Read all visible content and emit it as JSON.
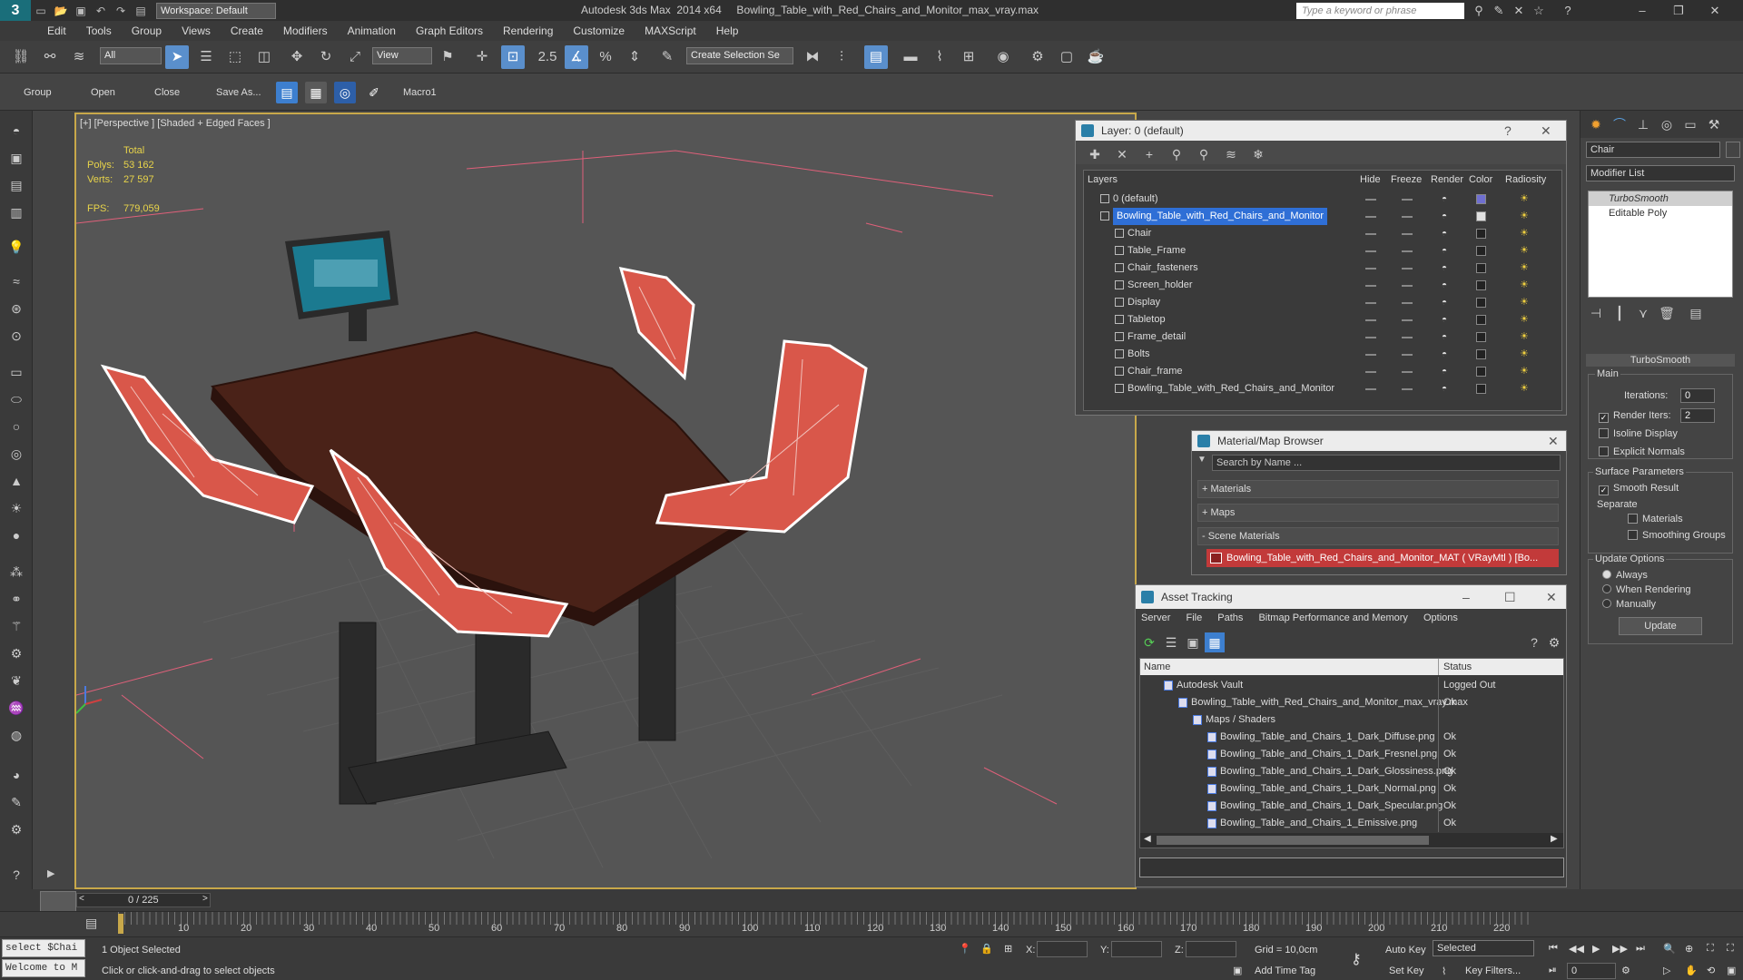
{
  "app": {
    "logo": "3",
    "workspace": "Workspace: Default",
    "window_title": "Autodesk 3ds Max  2014 x64     Bowling_Table_with_Red_Chairs_and_Monitor_max_vray.max",
    "search_placeholder": "Type a keyword or phrase"
  },
  "menu": [
    "Edit",
    "Tools",
    "Group",
    "Views",
    "Create",
    "Modifiers",
    "Animation",
    "Graph Editors",
    "Rendering",
    "Customize",
    "MAXScript",
    "Help"
  ],
  "toolbar": {
    "filter": "All",
    "ref_coord": "View",
    "snap_value": "2.5",
    "selection_set": "Create Selection Se"
  },
  "ribbon": {
    "group": "Group",
    "open": "Open",
    "close": "Close",
    "save_as": "Save As...",
    "macro": "Macro1"
  },
  "viewport": {
    "label": "[+] [Perspective ] [Shaded + Edged Faces ]",
    "total_label": "Total",
    "polys_label": "Polys:",
    "polys": "53 162",
    "verts_label": "Verts:",
    "verts": "27 597",
    "fps_label": "FPS:",
    "fps": "779,059"
  },
  "layer_panel": {
    "title": "Layer: 0 (default)",
    "help": "?",
    "close": "✕",
    "columns": [
      "Layers",
      "Hide",
      "Freeze",
      "Render",
      "Color",
      "Radiosity"
    ],
    "rows": [
      {
        "name": "0 (default)",
        "level": 0,
        "selected": false,
        "color": "#6f6fd0"
      },
      {
        "name": "Bowling_Table_with_Red_Chairs_and_Monitor",
        "level": 0,
        "selected": true,
        "color": "#e0e0e0"
      },
      {
        "name": "Chair",
        "level": 1,
        "selected": false,
        "color": "#222222"
      },
      {
        "name": "Table_Frame",
        "level": 1,
        "selected": false,
        "color": "#222222"
      },
      {
        "name": "Chair_fasteners",
        "level": 1,
        "selected": false,
        "color": "#222222"
      },
      {
        "name": "Screen_holder",
        "level": 1,
        "selected": false,
        "color": "#222222"
      },
      {
        "name": "Display",
        "level": 1,
        "selected": false,
        "color": "#222222"
      },
      {
        "name": "Tabletop",
        "level": 1,
        "selected": false,
        "color": "#222222"
      },
      {
        "name": "Frame_detail",
        "level": 1,
        "selected": false,
        "color": "#222222"
      },
      {
        "name": "Bolts",
        "level": 1,
        "selected": false,
        "color": "#222222"
      },
      {
        "name": "Chair_frame",
        "level": 1,
        "selected": false,
        "color": "#222222"
      },
      {
        "name": "Bowling_Table_with_Red_Chairs_and_Monitor",
        "level": 1,
        "selected": false,
        "color": "#222222"
      }
    ]
  },
  "material_browser": {
    "title": "Material/Map Browser",
    "close": "✕",
    "search_placeholder": "Search by Name ...",
    "sections": [
      "+ Materials",
      "+ Maps",
      "- Scene Materials"
    ],
    "scene_material": "Bowling_Table_with_Red_Chairs_and_Monitor_MAT ( VRayMtl ) [Bo..."
  },
  "asset_tracking": {
    "title": "Asset Tracking",
    "menu": [
      "Server",
      "File",
      "Paths",
      "Bitmap Performance and Memory",
      "Options"
    ],
    "col_name": "Name",
    "col_status": "Status",
    "rows": [
      {
        "name": "Autodesk Vault",
        "indent": 1,
        "status": "Logged Out"
      },
      {
        "name": "Bowling_Table_with_Red_Chairs_and_Monitor_max_vray.max",
        "indent": 2,
        "status": "Ok"
      },
      {
        "name": "Maps / Shaders",
        "indent": 3,
        "status": ""
      },
      {
        "name": "Bowling_Table_and_Chairs_1_Dark_Diffuse.png",
        "indent": 4,
        "status": "Ok"
      },
      {
        "name": "Bowling_Table_and_Chairs_1_Dark_Fresnel.png",
        "indent": 4,
        "status": "Ok"
      },
      {
        "name": "Bowling_Table_and_Chairs_1_Dark_Glossiness.png",
        "indent": 4,
        "status": "Ok"
      },
      {
        "name": "Bowling_Table_and_Chairs_1_Dark_Normal.png",
        "indent": 4,
        "status": "Ok"
      },
      {
        "name": "Bowling_Table_and_Chairs_1_Dark_Specular.png",
        "indent": 4,
        "status": "Ok"
      },
      {
        "name": "Bowling_Table_and_Chairs_1_Emissive.png",
        "indent": 4,
        "status": "Ok"
      }
    ]
  },
  "command_panel": {
    "object_name": "Chair",
    "modifier_list": "Modifier List",
    "stack": [
      "TurboSmooth",
      "Editable Poly"
    ],
    "rollout_title": "TurboSmooth",
    "main_label": "Main",
    "iterations_label": "Iterations:",
    "iterations": "0",
    "render_iters_label": "Render Iters:",
    "render_iters": "2",
    "isoline": "Isoline Display",
    "explicit_normals": "Explicit Normals",
    "surface_params": "Surface Parameters",
    "smooth_result": "Smooth Result",
    "separate": "Separate",
    "materials": "Materials",
    "smoothing_groups": "Smoothing Groups",
    "update_options": "Update Options",
    "always": "Always",
    "when_rendering": "When Rendering",
    "manually": "Manually",
    "update": "Update"
  },
  "timeline": {
    "frame": "0 / 225",
    "ticks": [
      "10",
      "20",
      "30",
      "40",
      "50",
      "60",
      "70",
      "80",
      "90",
      "100",
      "110",
      "120",
      "130",
      "140",
      "150",
      "160",
      "170",
      "180",
      "190",
      "200",
      "210",
      "220"
    ]
  },
  "status": {
    "script1": "select $Chai",
    "script2": "Welcome to M",
    "selected": "1 Object Selected",
    "prompt": "Click or click-and-drag to select objects",
    "x_label": "X:",
    "y_label": "Y:",
    "z_label": "Z:",
    "grid": "Grid = 10,0cm",
    "add_time_tag": "Add Time Tag",
    "auto_key": "Auto Key",
    "set_key": "Set Key",
    "selected_dd": "Selected",
    "key_filters": "Key Filters...",
    "frame_field": "0"
  }
}
